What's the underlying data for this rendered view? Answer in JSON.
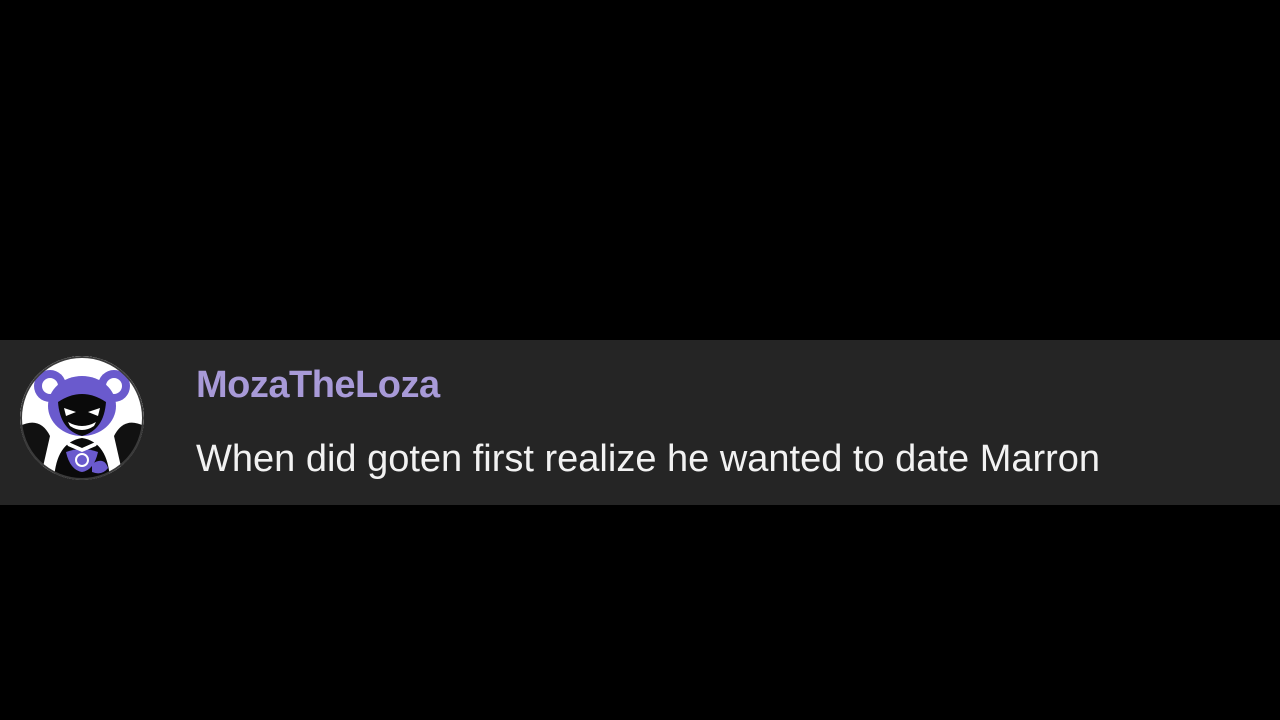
{
  "comment": {
    "username": "MozaTheLoza",
    "message": "When did goten first realize he wanted to date Marron",
    "avatar_icon": "purple-cartoon-character-avatar"
  },
  "colors": {
    "background": "#000000",
    "comment_bar": "#252525",
    "username": "#a89ad8",
    "message": "#f2f2f2",
    "avatar_purple": "#6a5acd"
  }
}
